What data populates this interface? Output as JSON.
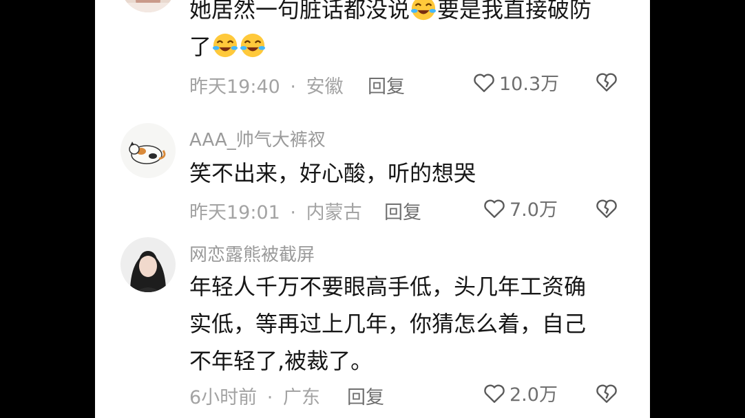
{
  "comments": [
    {
      "text_line1": "她居然一句脏话都没说",
      "text_line1b": "要是我直接破防",
      "text_line2": "了",
      "time": "昨天19:40",
      "location": "安徽",
      "reply_label": "回复",
      "likes": "10.3万"
    },
    {
      "username": "AAA_帅气大裤衩",
      "text": "笑不出来，好心酸，听的想哭",
      "time": "昨天19:01",
      "location": "内蒙古",
      "reply_label": "回复",
      "likes": "7.0万"
    },
    {
      "username": "网恋露熊被截屏",
      "text_lines": [
        "年轻人千万不要眼高手低，头几年工资确",
        "实低，等再过上几年，你猜怎么着，自己",
        "不年轻了,被裁了。"
      ],
      "time": "6小时前",
      "location": "广东",
      "reply_label": "回复",
      "likes": "2.0万"
    }
  ],
  "separator": "·",
  "icons": {
    "avatar": "avatar-image",
    "like": "heart-outline-icon",
    "dislike": "broken-heart-icon",
    "emoji": "laughing-crying-emoji"
  }
}
